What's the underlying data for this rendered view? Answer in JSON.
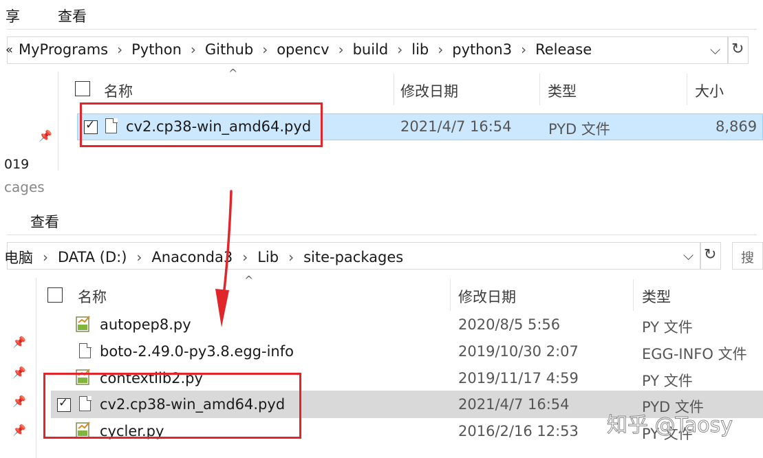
{
  "top": {
    "toolbar_share": "享",
    "toolbar_view": "查看",
    "breadcrumb_prefix": "«",
    "breadcrumb": [
      "MyPrograms",
      "Python",
      "Github",
      "opencv",
      "build",
      "lib",
      "python3",
      "Release"
    ],
    "columns": [
      "名称",
      "修改日期",
      "类型",
      "大小"
    ],
    "file": {
      "name": "cv2.cp38-win_amd64.pyd",
      "date": "2021/4/7 16:54",
      "type": "PYD 文件",
      "size": "8,869"
    },
    "left_fragment": "019"
  },
  "bottom": {
    "window_fragment": "cages",
    "toolbar_view": "查看",
    "breadcrumb": [
      "电脑",
      "DATA (D:)",
      "Anaconda3",
      "Lib",
      "site-packages"
    ],
    "search_fragment": "搜",
    "columns": [
      "名称",
      "修改日期",
      "类型"
    ],
    "files": [
      {
        "name": "autopep8.py",
        "date": "2020/8/5 5:56",
        "type": "PY 文件",
        "icon": "python-file-icon"
      },
      {
        "name": "boto-2.49.0-py3.8.egg-info",
        "date": "2019/10/30 2:07",
        "type": "EGG-INFO 文件",
        "icon": "file-icon"
      },
      {
        "name": "contextlib2.py",
        "date": "2019/11/17 4:59",
        "type": "PY 文件",
        "icon": "python-file-icon"
      },
      {
        "name": "cv2.cp38-win_amd64.pyd",
        "date": "2021/4/7 16:54",
        "type": "PYD 文件",
        "icon": "file-icon"
      },
      {
        "name": "cycler.py",
        "date": "2016/2/16 12:53",
        "type": "PY 文件",
        "icon": "python-file-icon"
      }
    ]
  },
  "watermark": "知乎 @Taosy",
  "colors": {
    "selected_row": "#cce8ff",
    "gray_row": "#d9d9d9",
    "annotation_red": "#e0262b"
  }
}
